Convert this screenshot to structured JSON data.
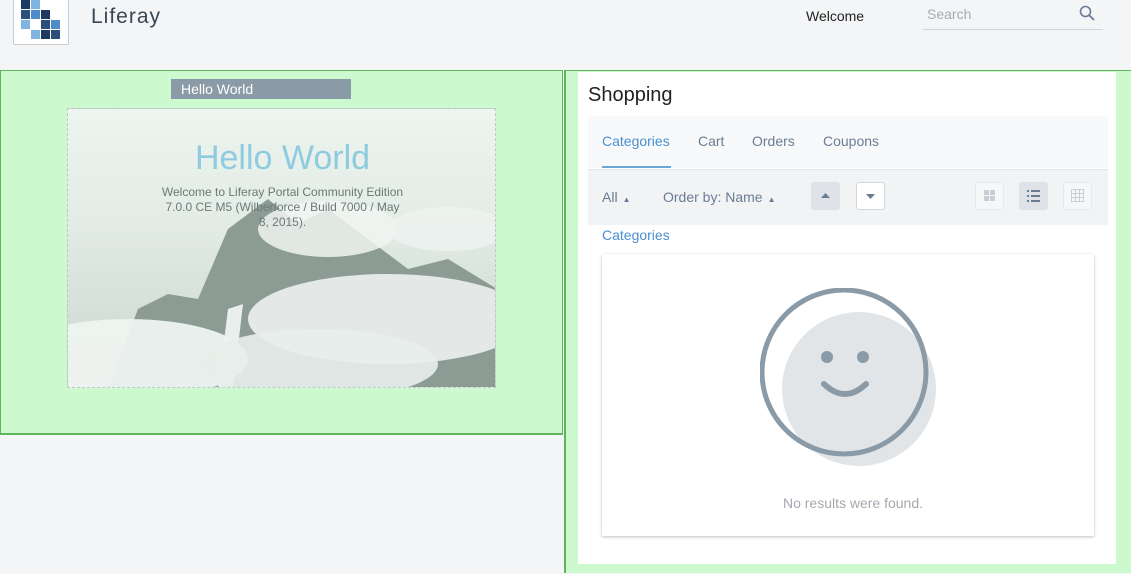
{
  "header": {
    "brand": "Liferay",
    "welcome": "Welcome",
    "search_placeholder": "Search"
  },
  "left": {
    "portlet_title": "Hello World",
    "hero_title": "Hello World",
    "hero_text": "Welcome to Liferay Portal Community Edition 7.0.0 CE M5 (Wilberforce / Build 7000 / May 8, 2015)."
  },
  "shopping": {
    "title": "Shopping",
    "tabs": [
      "Categories",
      "Cart",
      "Orders",
      "Coupons"
    ],
    "active_tab": "Categories",
    "filter_label": "All",
    "order_label": "Order by: Name",
    "breadcrumb": "Categories",
    "empty_message": "No results were found."
  },
  "colors": {
    "accent": "#4a8fd0",
    "portlet_bg": "#ccf9cd",
    "portlet_border": "#62b35e"
  }
}
